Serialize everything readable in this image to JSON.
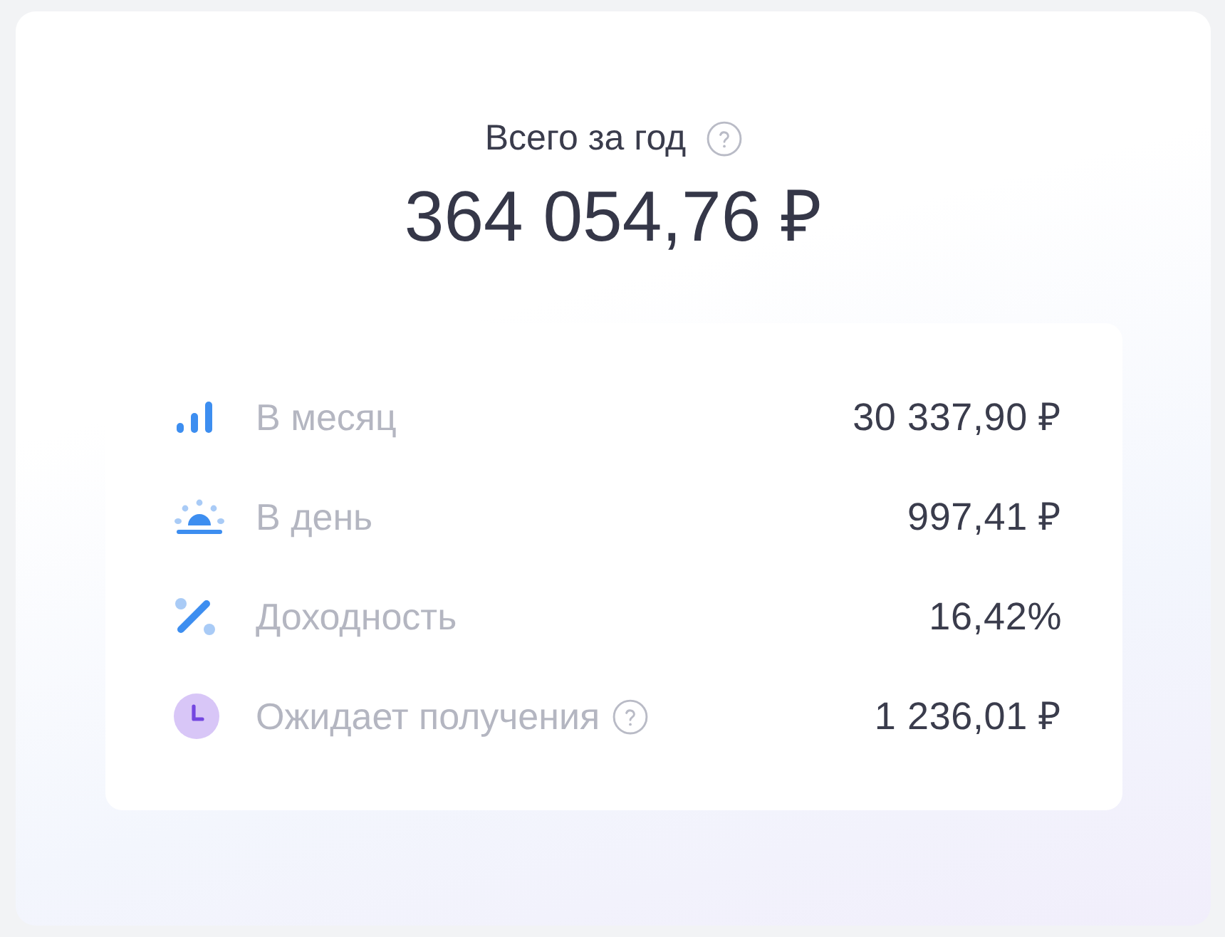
{
  "summary": {
    "title": "Всего за год",
    "total": "364 054,76 ₽"
  },
  "rows": [
    {
      "kind": "bars",
      "label": "В месяц",
      "help": false,
      "value": "30 337,90 ₽"
    },
    {
      "kind": "sunrise",
      "label": "В день",
      "help": false,
      "value": "997,41 ₽"
    },
    {
      "kind": "percent",
      "label": "Доходность",
      "help": false,
      "value": "16,42%"
    },
    {
      "kind": "clock",
      "label": "Ожидает получения",
      "help": true,
      "value": "1 236,01 ₽"
    }
  ]
}
